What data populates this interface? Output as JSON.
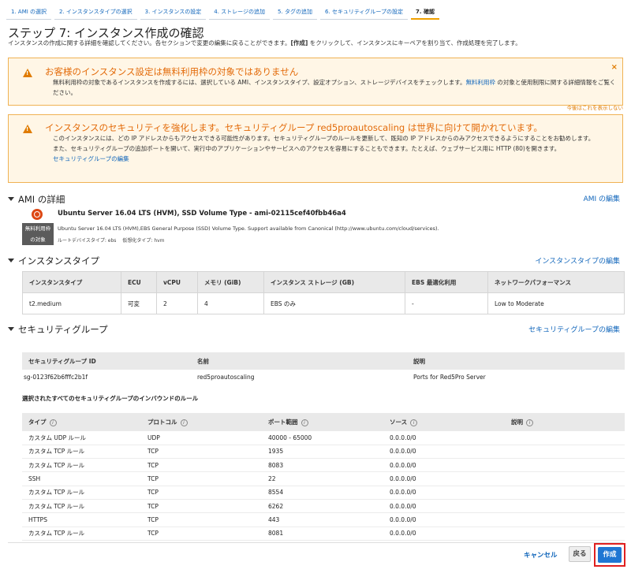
{
  "steps": [
    {
      "label": "1. AMI の選択"
    },
    {
      "label": "2. インスタンスタイプの選択"
    },
    {
      "label": "3. インスタンスの設定"
    },
    {
      "label": "4. ストレージの追加"
    },
    {
      "label": "5. タグの追加"
    },
    {
      "label": "6. セキュリティグループの設定"
    },
    {
      "label": "7. 確認"
    }
  ],
  "page": {
    "title": "ステップ 7: インスタンス作成の確認",
    "subtitle_pre": "インスタンスの作成に関する詳細を確認してください。各セクションで変更の編集に戻ることができます。",
    "subtitle_bold": "[作成]",
    "subtitle_post": " をクリックして、インスタンスにキーペアを割り当て、作成処理を完了します。"
  },
  "warning_free": {
    "title": "お客様のインスタンス設定は無料利用枠の対象ではありません",
    "body_pre": "無料利用枠の対象であるインスタンスを作成するには、選択している AMI、インスタンスタイプ、設定オプション、ストレージデバイスをチェックします。",
    "link": "無料利用枠",
    "body_post": " の対象と使用制限に関する詳細情報をご覧ください。",
    "dismiss": "今後はこれを表示しない"
  },
  "warning_security": {
    "title": "インスタンスのセキュリティを強化します。セキュリティグループ red5proautoscaling は世界に向けて開かれています。",
    "body1": "このインスタンスには、どの IP アドレスからもアクセスできる可能性があります。セキュリティグループのルールを更新して、既知の IP アドレスからのみアクセスできるようにすることをお勧めします。",
    "body2": "また、セキュリティグループの追加ポートを開いて、実行中のアプリケーションやサービスへのアクセスを容易にすることもできます。たとえば、ウェブサービス用に HTTP (80)を開きます。",
    "link": "セキュリティグループの編集"
  },
  "ami": {
    "header": "AMI の詳細",
    "edit": "AMI の編集",
    "name": "Ubuntu Server 16.04 LTS (HVM), SSD Volume Type - ami-02115cef40fbb46a4",
    "free_tag_line1": "無料利用枠",
    "free_tag_line2": "の対象",
    "description": "Ubuntu Server 16.04 LTS (HVM),EBS General Purpose (SSD) Volume Type. Support available from Canonical (http://www.ubuntu.com/cloud/services).",
    "root_device": "ルートデバイスタイプ: ebs",
    "virtualization": "仮想化タイプ: hvm"
  },
  "instance_type": {
    "header": "インスタンスタイプ",
    "edit": "インスタンスタイプの編集",
    "columns": [
      "インスタンスタイプ",
      "ECU",
      "vCPU",
      "メモリ (GiB)",
      "インスタンス ストレージ (GB)",
      "EBS 最適化利用",
      "ネットワークパフォーマンス"
    ],
    "row": [
      "t2.medium",
      "可変",
      "2",
      "4",
      "EBS のみ",
      "-",
      "Low to Moderate"
    ]
  },
  "security_group": {
    "header": "セキュリティグループ",
    "edit": "セキュリティグループの編集",
    "columns": [
      "セキュリティグループ ID",
      "名前",
      "説明"
    ],
    "row": [
      "sg-0123f62b6fffc2b1f",
      "red5proautoscaling",
      "Ports for Red5Pro Server"
    ],
    "inbound_header": "選択されたすべてのセキュリティグループのインバウンドのルール",
    "rule_columns": [
      "タイプ",
      "プロトコル",
      "ポート範囲",
      "ソース",
      "説明"
    ],
    "rules": [
      [
        "カスタム UDP ルール",
        "UDP",
        "40000 - 65000",
        "0.0.0.0/0",
        ""
      ],
      [
        "カスタム TCP ルール",
        "TCP",
        "1935",
        "0.0.0.0/0",
        ""
      ],
      [
        "カスタム TCP ルール",
        "TCP",
        "8083",
        "0.0.0.0/0",
        ""
      ],
      [
        "SSH",
        "TCP",
        "22",
        "0.0.0.0/0",
        ""
      ],
      [
        "カスタム TCP ルール",
        "TCP",
        "8554",
        "0.0.0.0/0",
        ""
      ],
      [
        "カスタム TCP ルール",
        "TCP",
        "6262",
        "0.0.0.0/0",
        ""
      ],
      [
        "HTTPS",
        "TCP",
        "443",
        "0.0.0.0/0",
        ""
      ],
      [
        "カスタム TCP ルール",
        "TCP",
        "8081",
        "0.0.0.0/0",
        ""
      ]
    ]
  },
  "footer": {
    "cancel": "キャンセル",
    "back": "戻る",
    "create": "作成"
  },
  "icons": {
    "info": "i",
    "close": "×"
  },
  "colors": {
    "link": "#1166bb",
    "warning_title": "#e36b0a",
    "warning_bg": "#fff6e6",
    "primary_button": "#1f76d3",
    "highlight": "#e02020"
  }
}
